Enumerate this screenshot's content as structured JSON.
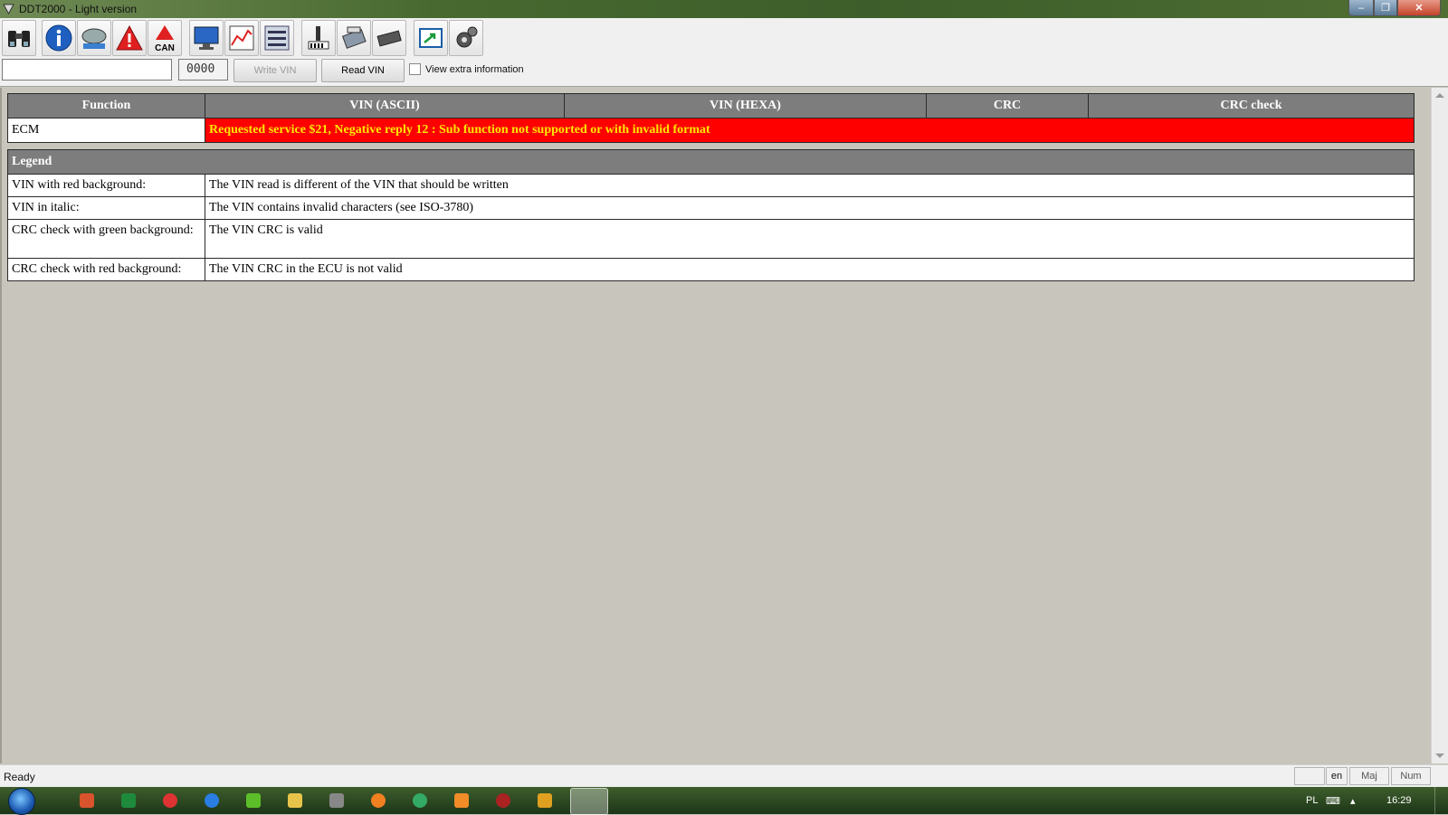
{
  "window": {
    "title": "DDT2000 - Light version",
    "min": "–",
    "max": "❐",
    "close": "✕"
  },
  "toolbar": {
    "icons": [
      "binoculars-icon",
      "info-icon",
      "ecu-icon",
      "warning-icon",
      "can-warning-icon",
      "monitor-icon",
      "graph-icon",
      "parameters-icon",
      "tools-icon",
      "programming-icon",
      "chip-icon",
      "export-icon",
      "settings-icon"
    ],
    "can_label": "CAN"
  },
  "vin_row": {
    "vin_value": "",
    "crc_value": "0000",
    "write_label": "Write VIN",
    "read_label": "Read VIN",
    "extra_info_label": "View extra information"
  },
  "table": {
    "headers": [
      "Function",
      "VIN (ASCII)",
      "VIN (HEXA)",
      "CRC",
      "CRC check"
    ],
    "rows": [
      {
        "function": "ECM",
        "message": "Requested service $21, Negative reply 12 : Sub function not supported or with invalid format"
      }
    ]
  },
  "legend": {
    "title": "Legend",
    "rows": [
      {
        "key": "VIN with red background:",
        "desc": "The VIN read is different of the VIN that should be written"
      },
      {
        "key": "VIN in italic:",
        "desc": "The VIN contains invalid characters (see ISO-3780)"
      },
      {
        "key": "CRC check with green background:",
        "desc": "The VIN CRC is valid"
      },
      {
        "key": "CRC check with red background:",
        "desc": "The VIN CRC in the ECU is not valid"
      }
    ]
  },
  "statusbar": {
    "status": "Ready",
    "lang": "en",
    "caps": "Maj",
    "num": "Num"
  },
  "taskbar": {
    "layout": "PL",
    "time": "16:29"
  },
  "colors": {
    "error_bg": "#ff0000",
    "error_text": "#ffe600",
    "header_bg": "#7d7d7d"
  }
}
